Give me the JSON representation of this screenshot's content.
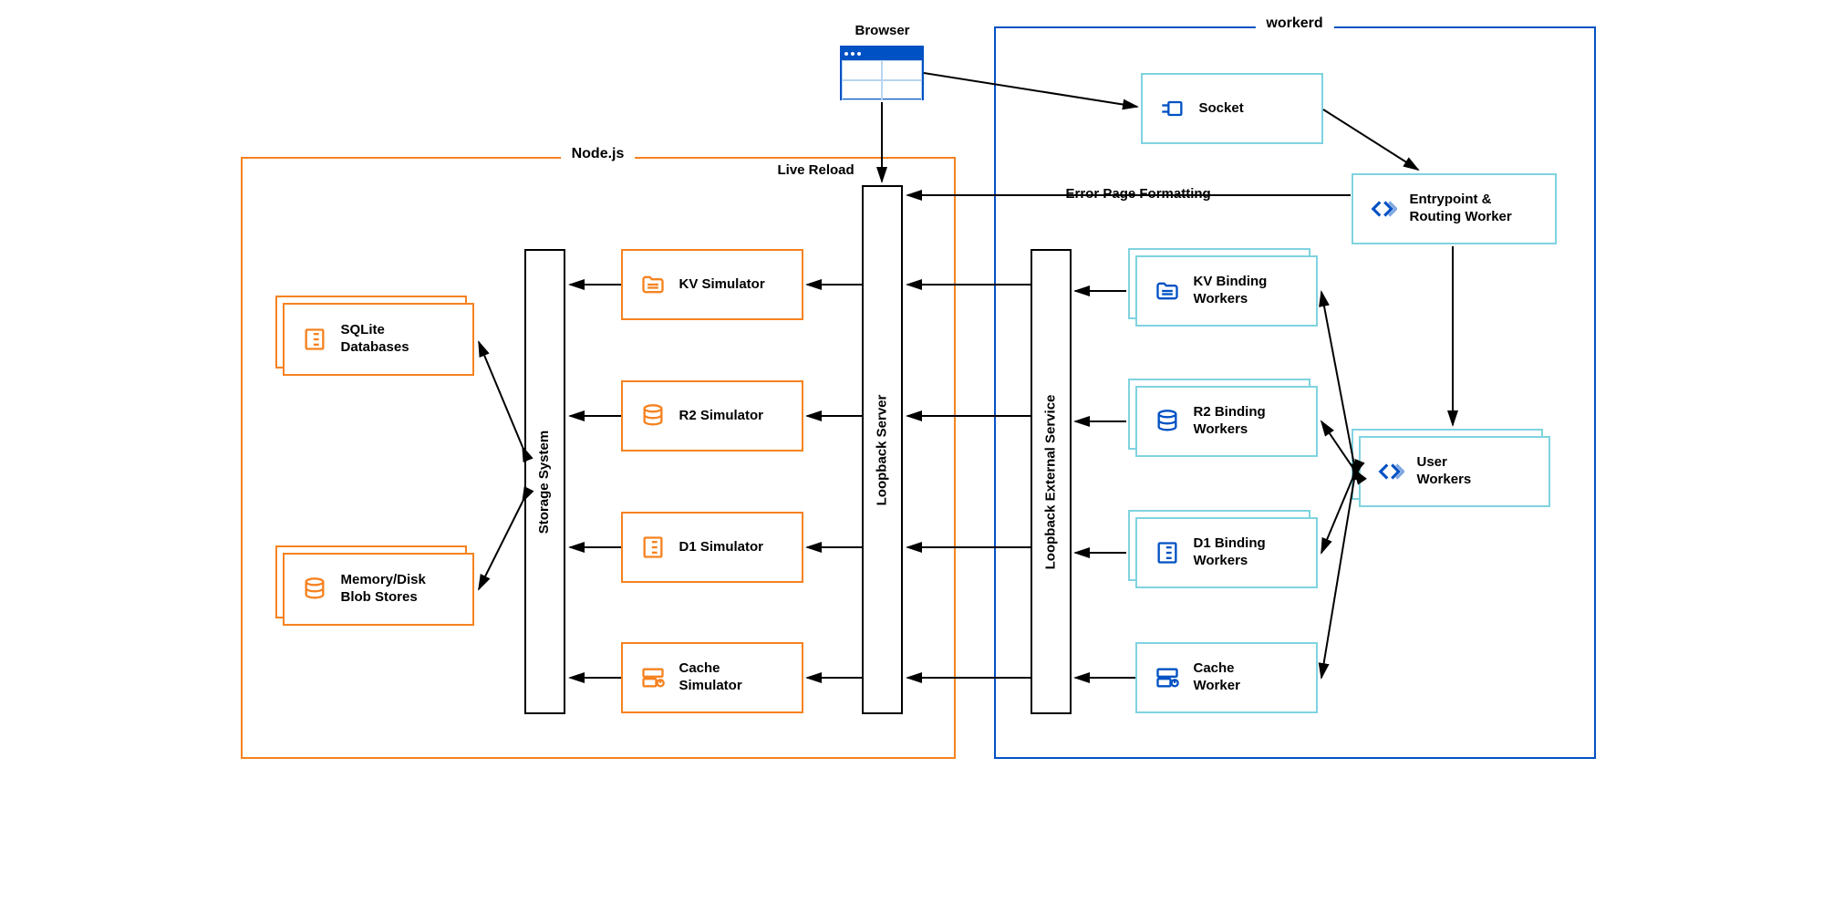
{
  "containers": {
    "nodejs": "Node.js",
    "workerd": "workerd"
  },
  "browser_label": "Browser",
  "edges": {
    "live_reload": "Live Reload",
    "error_page": "Error Page Formatting"
  },
  "vertical": {
    "storage": "Storage System",
    "loopback": "Loopback Server",
    "loopback_ext": "Loopback External Service"
  },
  "nodes": {
    "sqlite": "SQLite\nDatabases",
    "memdisk": "Memory/Disk\nBlob Stores",
    "kv_sim": "KV Simulator",
    "r2_sim": "R2 Simulator",
    "d1_sim": "D1 Simulator",
    "cache_sim": "Cache\nSimulator",
    "socket": "Socket",
    "entry": "Entrypoint &\nRouting Worker",
    "user": "User\nWorkers",
    "kv_bind": "KV Binding\nWorkers",
    "r2_bind": "R2 Binding\nWorkers",
    "d1_bind": "D1 Binding\nWorkers",
    "cache_worker": "Cache\nWorker"
  },
  "colors": {
    "orange": "#f6821f",
    "blue": "#0051c3",
    "cyan": "#7fd3e0",
    "black": "#000000"
  }
}
